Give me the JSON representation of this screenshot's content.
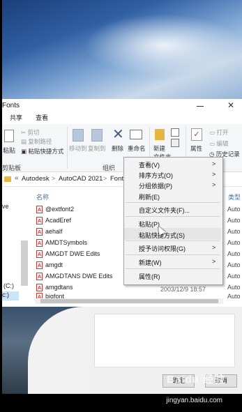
{
  "window": {
    "title": "Fonts",
    "close_glyph": "✕",
    "minimize": "—"
  },
  "tabs": [
    "共享",
    "查看"
  ],
  "ribbon": {
    "paste": "粘贴",
    "cut": "剪切",
    "copy_path": "复制路径",
    "paste_shortcut": "粘贴快捷方式",
    "move_to": "移动到",
    "copy_to": "复制到",
    "delete": "删除",
    "rename": "重命名",
    "new_folder_l1": "新建",
    "new_folder_l2": "文件夹",
    "properties": "属性",
    "open": "打开",
    "edit": "编辑",
    "history": "历史记录",
    "clipboard_group": "剪贴板",
    "organize_group": "组织"
  },
  "address": {
    "chevrons": "«",
    "crumbs": [
      "Autodesk",
      "AutoCAD 2021",
      "Fonts"
    ],
    "sep": ">"
  },
  "nav": {
    "item1": "ve",
    "item2": "(C:)",
    "item3": "c:)"
  },
  "columns": {
    "name": "名称",
    "type": "类型"
  },
  "files": [
    {
      "name": "@extfont2",
      "type": "Auto"
    },
    {
      "name": "AcadEref",
      "type": "Auto"
    },
    {
      "name": "aehalf",
      "type": "Auto"
    },
    {
      "name": "AMDTSymbols",
      "type": "Auto"
    },
    {
      "name": "AMGDT DWE Edits",
      "type": "Auto"
    },
    {
      "name": "amgdt",
      "type": "Auto"
    },
    {
      "name": "AMGDTANS DWE Edits",
      "type": "Auto"
    },
    {
      "name": "amgdtans",
      "type": "Auto"
    },
    {
      "name": "bigfont",
      "date": "2003/12/9 18:57",
      "type": "Auto"
    }
  ],
  "context_menu": {
    "items": [
      {
        "label": "查看(V)",
        "submenu": true
      },
      {
        "label": "排序方式(O)",
        "submenu": true
      },
      {
        "label": "分组依据(P)",
        "submenu": true
      },
      {
        "label": "刷新(E)",
        "submenu": false
      },
      {
        "label": "自定义文件夹(F)...",
        "submenu": false
      },
      {
        "label": "粘贴(P)",
        "submenu": false
      },
      {
        "label": "粘贴快捷方式(S)",
        "submenu": false
      },
      {
        "label": "授予访问权限(G)",
        "submenu": true
      },
      {
        "label": "新建(W)",
        "submenu": true
      },
      {
        "label": "属性(R)",
        "submenu": false
      }
    ],
    "arrow": ">"
  },
  "dialog": {
    "ok": "确定",
    "cancel": "取消"
  },
  "watermark": {
    "brand": "Baidu 经验",
    "url": "jingyan.baidu.com"
  }
}
